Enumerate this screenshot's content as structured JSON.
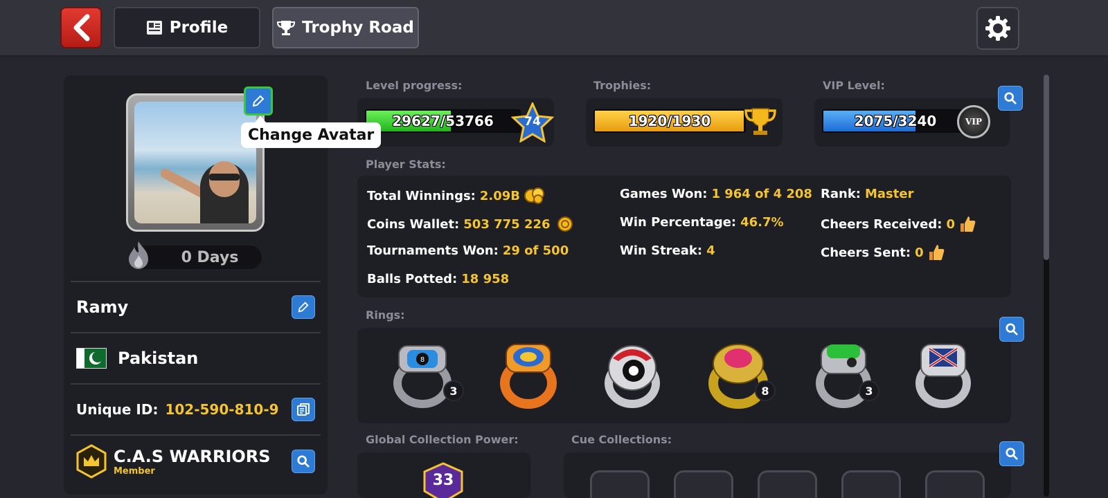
{
  "nav": {
    "profile_tab": "Profile",
    "trophy_tab": "Trophy Road"
  },
  "left": {
    "tooltip": "Change Avatar",
    "streak": "0 Days",
    "player_name": "Ramy",
    "country": "Pakistan",
    "unique_id_label": "Unique ID:",
    "unique_id_value": "102-590-810-9",
    "club_name": "C.A.S WARRIORS",
    "club_role": "Member"
  },
  "progress": {
    "level_label": "Level progress:",
    "level_value": "29627/53766",
    "level_number": "74",
    "level_fraction": 0.551,
    "trophies_label": "Trophies:",
    "trophies_value": "1920/1930",
    "trophies_fraction": 0.995,
    "vip_label": "VIP Level:",
    "vip_value": "2075/3240",
    "vip_fraction": 0.64,
    "vip_badge": "VIP"
  },
  "stats": {
    "label": "Player Stats:",
    "total_winnings_label": "Total Winnings:",
    "total_winnings_value": "2.09B",
    "coins_wallet_label": "Coins Wallet:",
    "coins_wallet_value": "503 775 226",
    "tournaments_won_label": "Tournaments Won:",
    "tournaments_won_value": "29 of 500",
    "balls_potted_label": "Balls Potted:",
    "balls_potted_value": "18 958",
    "games_won_label": "Games Won:",
    "games_won_value": "1 964 of 4 208",
    "win_percentage_label": "Win Percentage:",
    "win_percentage_value": "46.7%",
    "win_streak_label": "Win Streak:",
    "win_streak_value": "4",
    "rank_label": "Rank:",
    "rank_value": "Master",
    "cheers_received_label": "Cheers Received:",
    "cheers_received_value": "0",
    "cheers_sent_label": "Cheers Sent:",
    "cheers_sent_value": "0"
  },
  "rings": {
    "label": "Rings:",
    "counts": [
      "3",
      "8",
      "3"
    ]
  },
  "collections": {
    "global_label": "Global Collection Power:",
    "global_value": "33",
    "cue_label": "Cue Collections:"
  },
  "colors": {
    "accent_blue": "#2e7bd6",
    "value_yellow": "#f4c431",
    "level_green": "#37d92f",
    "trophy_yellow": "#f4b81c",
    "vip_blue": "#2a86e8"
  }
}
